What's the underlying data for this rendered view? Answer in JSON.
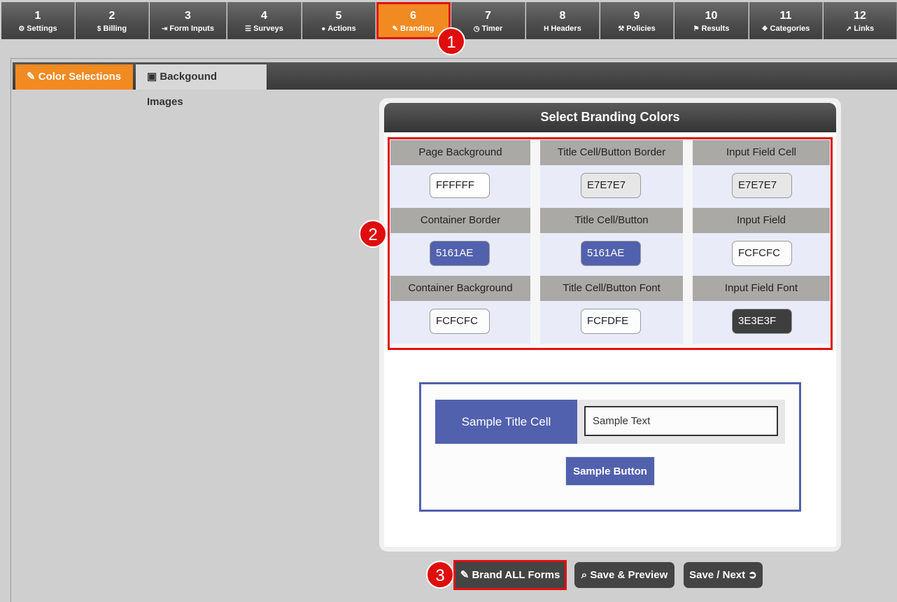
{
  "steps": [
    {
      "num": "1",
      "label": "Settings",
      "icon": "gear-icon",
      "glyph": "⚙"
    },
    {
      "num": "2",
      "label": "Billing",
      "icon": "dollar-icon",
      "glyph": "$"
    },
    {
      "num": "3",
      "label": "Form Inputs",
      "icon": "sign-in-icon",
      "glyph": "⇥"
    },
    {
      "num": "4",
      "label": "Surveys",
      "icon": "list-icon",
      "glyph": "☰"
    },
    {
      "num": "5",
      "label": "Actions",
      "icon": "user-icon",
      "glyph": "●"
    },
    {
      "num": "6",
      "label": "Branding",
      "icon": "brush-icon",
      "glyph": "✎"
    },
    {
      "num": "7",
      "label": "Timer",
      "icon": "clock-icon",
      "glyph": "◷"
    },
    {
      "num": "8",
      "label": "Headers",
      "icon": "header-icon",
      "glyph": "H"
    },
    {
      "num": "9",
      "label": "Policies",
      "icon": "gavel-icon",
      "glyph": "⚒"
    },
    {
      "num": "10",
      "label": "Results",
      "icon": "flag-icon",
      "glyph": "⚑"
    },
    {
      "num": "11",
      "label": "Categories",
      "icon": "cubes-icon",
      "glyph": "❖"
    },
    {
      "num": "12",
      "label": "Links",
      "icon": "pointer-icon",
      "glyph": "➚"
    }
  ],
  "markers": [
    "1",
    "2",
    "3"
  ],
  "subtabs": {
    "color_selections": "Color Selections",
    "background_images": "Backgound Images"
  },
  "panel": {
    "title": "Select Branding Colors",
    "fields": [
      {
        "label": "Page Background",
        "value": "FFFFFF",
        "color": "#FFFFFF",
        "text": "#222222"
      },
      {
        "label": "Title Cell/Button Border",
        "value": "E7E7E7",
        "color": "#E7E7E7",
        "text": "#222222"
      },
      {
        "label": "Input Field Cell",
        "value": "E7E7E7",
        "color": "#E7E7E7",
        "text": "#222222"
      },
      {
        "label": "Container Border",
        "value": "5161AE",
        "color": "#5161AE",
        "text": "#FFFFFF"
      },
      {
        "label": "Title Cell/Button",
        "value": "5161AE",
        "color": "#5161AE",
        "text": "#FFFFFF"
      },
      {
        "label": "Input Field",
        "value": "FCFCFC",
        "color": "#FCFCFC",
        "text": "#222222"
      },
      {
        "label": "Container Background",
        "value": "FCFCFC",
        "color": "#FCFCFC",
        "text": "#222222"
      },
      {
        "label": "Title Cell/Button Font",
        "value": "FCFDFE",
        "color": "#FCFDFE",
        "text": "#222222"
      },
      {
        "label": "Input Field Font",
        "value": "3E3E3F",
        "color": "#3E3E3F",
        "text": "#FFFFFF"
      }
    ]
  },
  "sample": {
    "title_cell": "Sample Title Cell",
    "input_value": "Sample Text",
    "button": "Sample Button"
  },
  "buttons": {
    "brand_all": "Brand ALL Forms",
    "save_preview": "Save & Preview",
    "save_next": "Save / Next"
  }
}
